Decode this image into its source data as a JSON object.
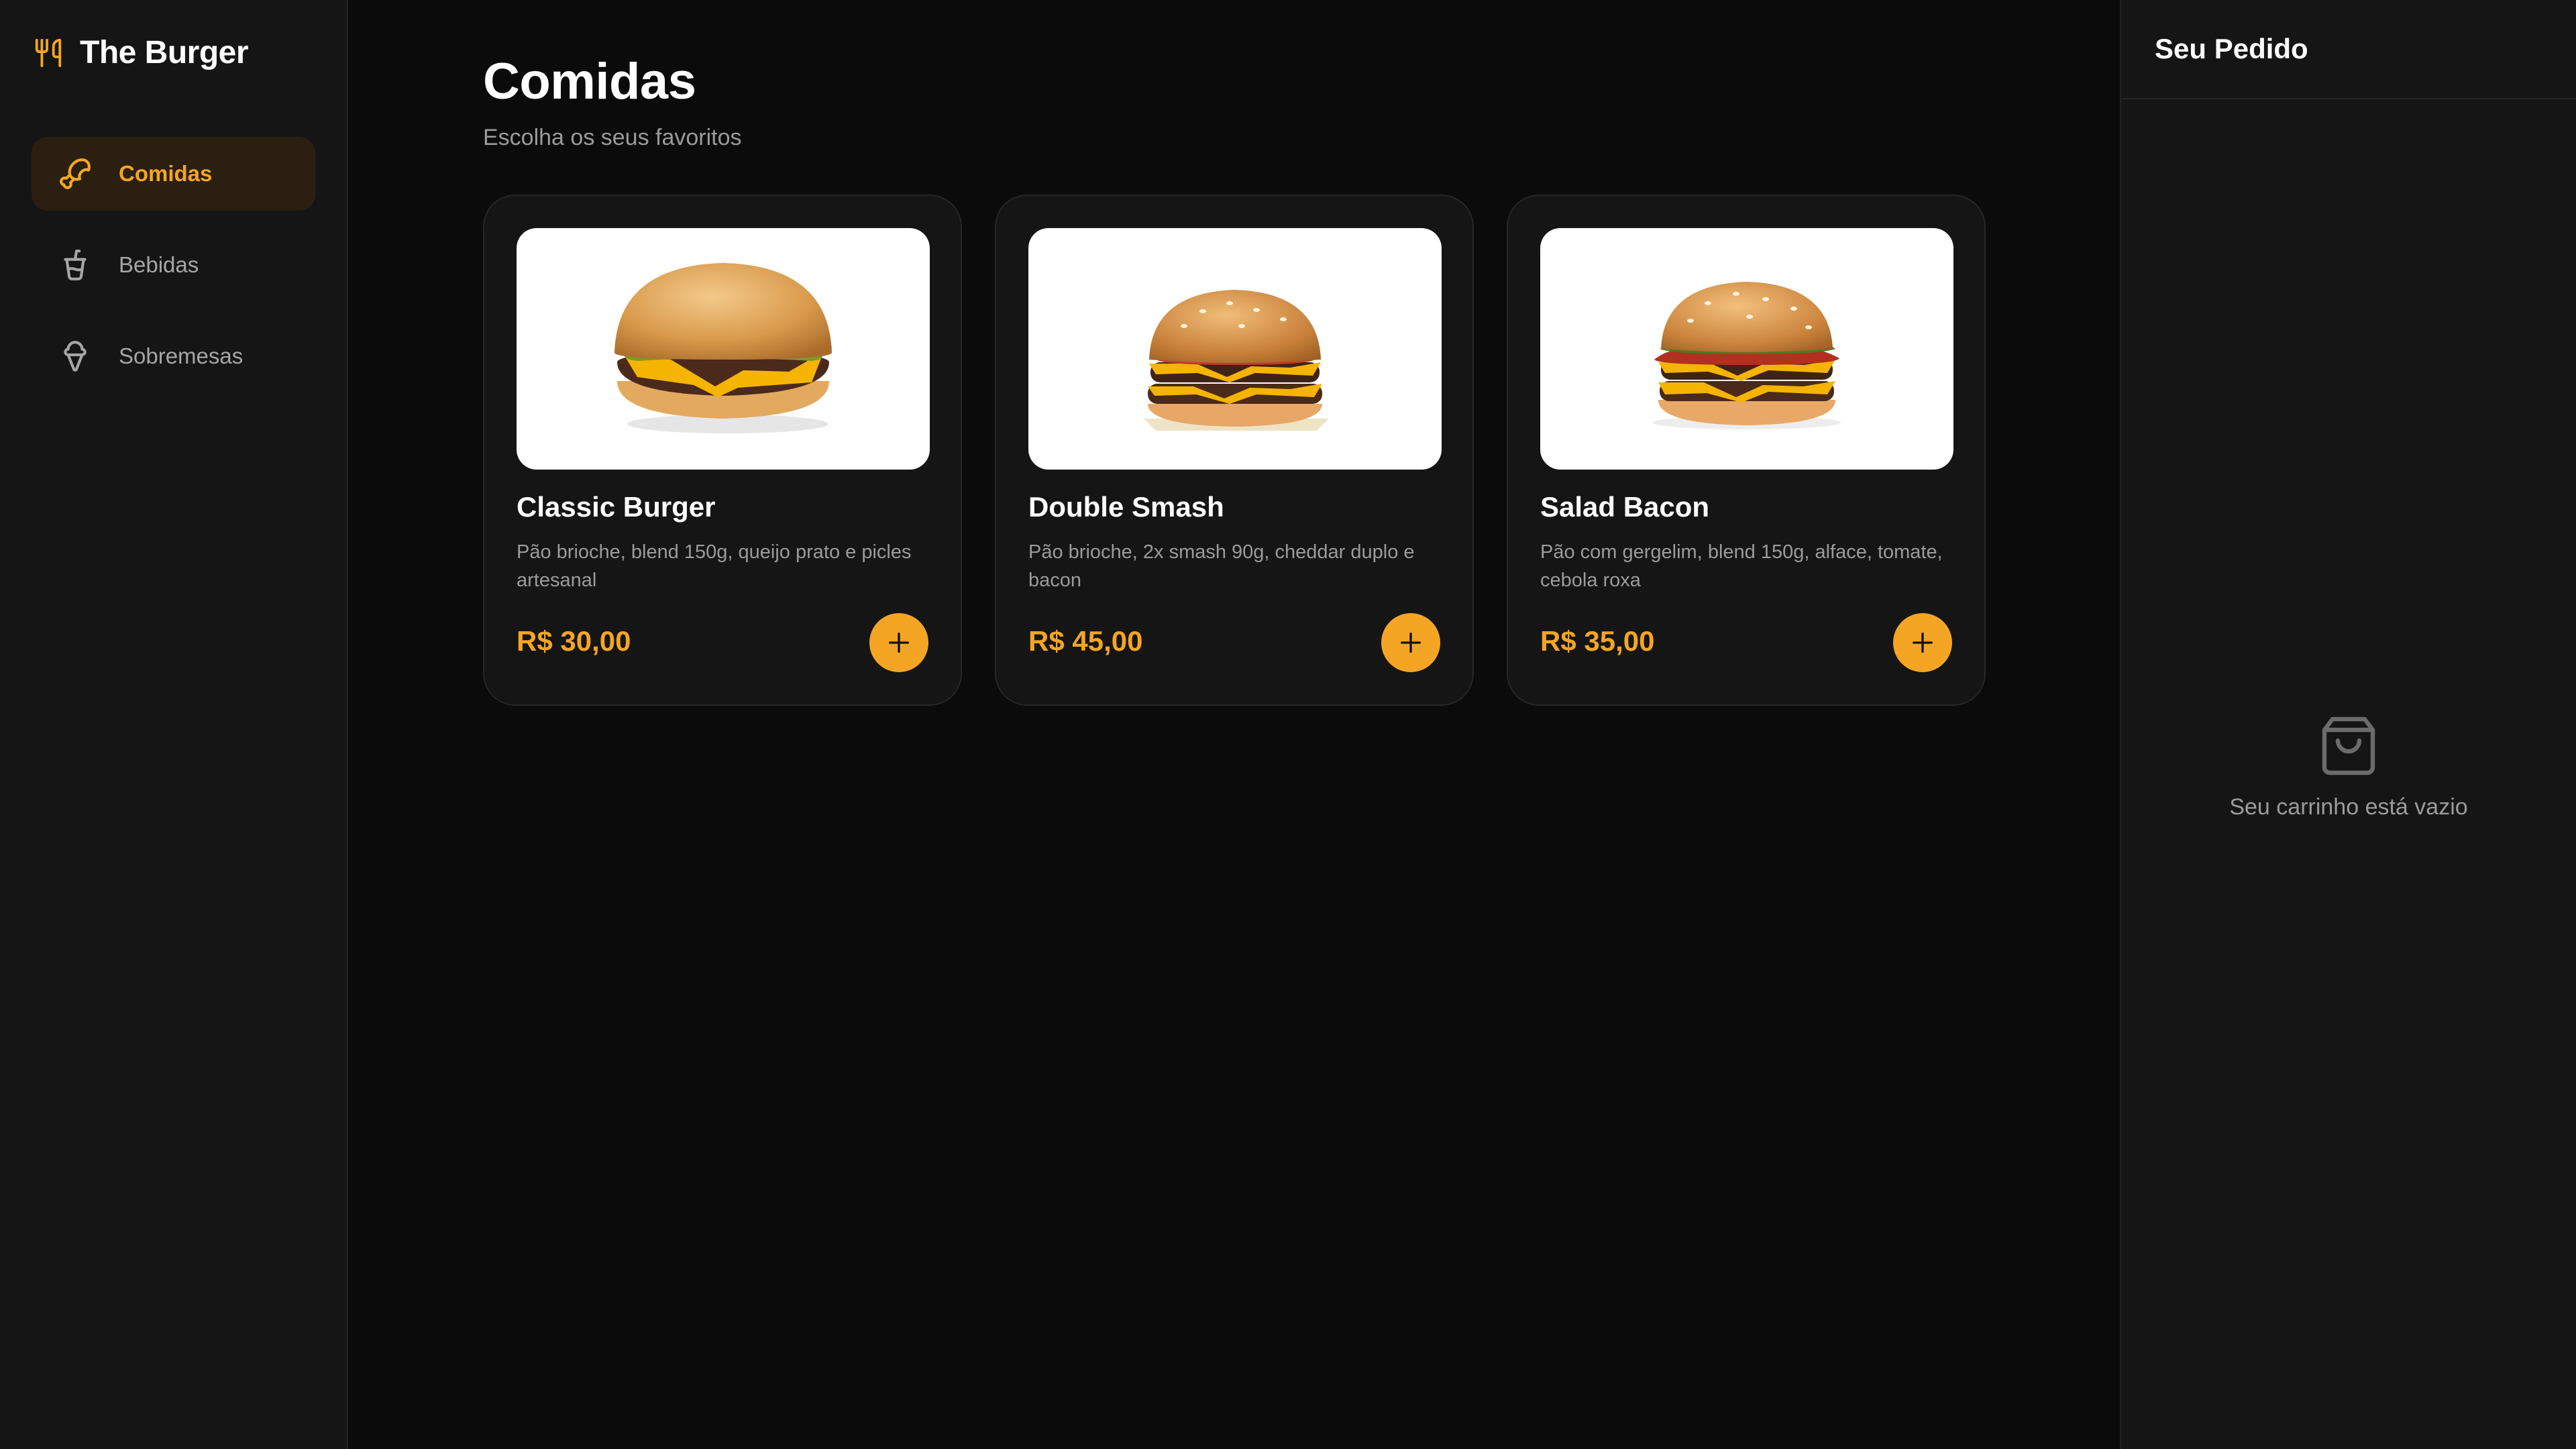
{
  "brand": {
    "name": "The Burger",
    "icon": "utensils-icon"
  },
  "sidebar": {
    "items": [
      {
        "label": "Comidas",
        "icon": "burger-icon",
        "active": true
      },
      {
        "label": "Bebidas",
        "icon": "cup-icon",
        "active": false
      },
      {
        "label": "Sobremesas",
        "icon": "ice-cream-icon",
        "active": false
      }
    ]
  },
  "main": {
    "title": "Comidas",
    "subtitle": "Escolha os seus favoritos",
    "products": [
      {
        "name": "Classic Burger",
        "description": "Pão brioche, blend 150g, queijo prato e picles artesanal",
        "price": "R$ 30,00",
        "image": "classic-burger-image"
      },
      {
        "name": "Double Smash",
        "description": "Pão brioche, 2x smash 90g, cheddar duplo e bacon",
        "price": "R$ 45,00",
        "image": "double-smash-image"
      },
      {
        "name": "Salad Bacon",
        "description": "Pão com gergelim, blend 150g, alface, tomate, cebola roxa",
        "price": "R$ 35,00",
        "image": "salad-bacon-image"
      }
    ],
    "add_icon": "plus-icon"
  },
  "order": {
    "title": "Seu Pedido",
    "empty_text": "Seu carrinho está vazio",
    "empty_icon": "shopping-bag-icon"
  },
  "colors": {
    "background": "#0b0b0b",
    "panel": "#151515",
    "accent": "#f5a524",
    "active_nav_bg": "#2a1f10",
    "muted_text": "#9b9b9b"
  }
}
